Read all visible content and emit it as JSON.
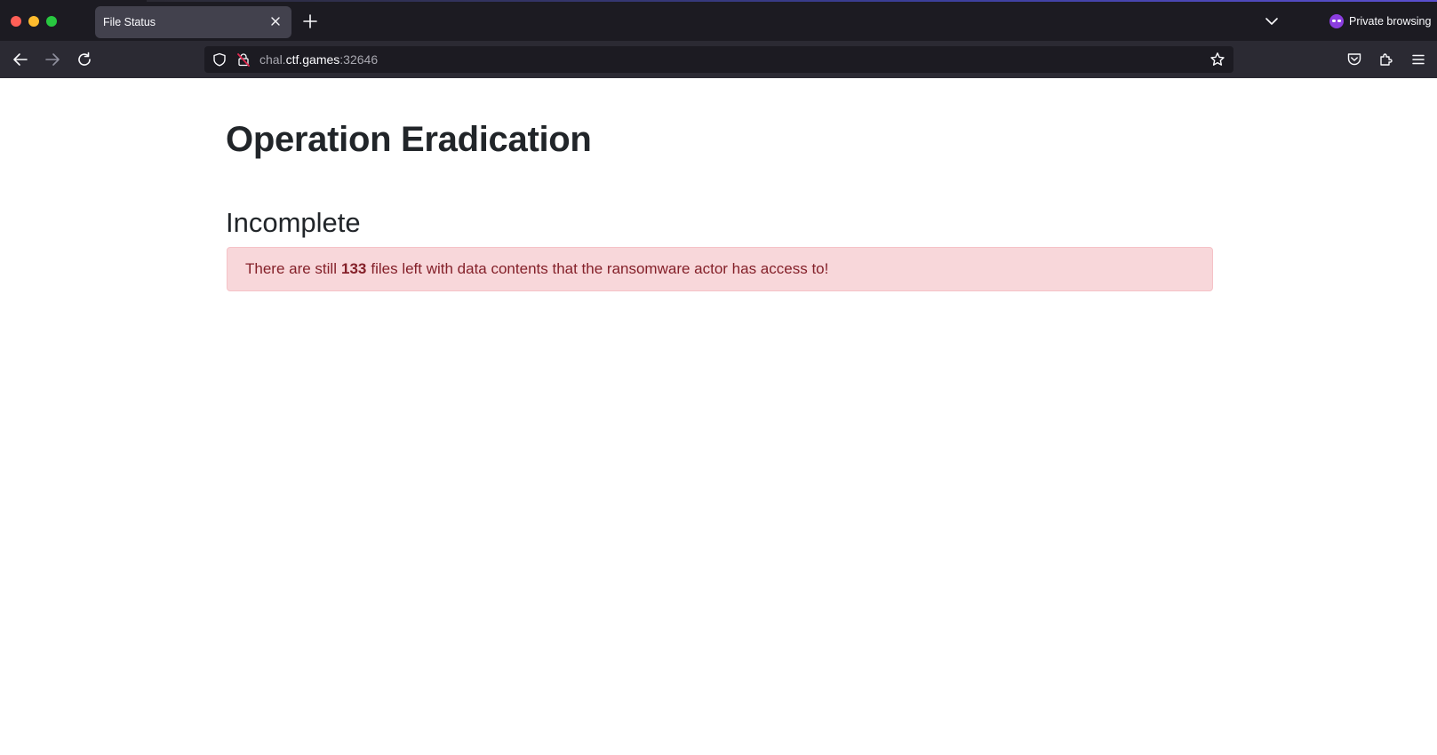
{
  "browser": {
    "tab": {
      "title": "File Status"
    },
    "private_label": "Private browsing",
    "url": {
      "prefix": "chal.",
      "domain": "ctf.games",
      "port": ":32646"
    },
    "colors": {
      "chrome_bg": "#1c1b22",
      "toolbar_bg": "#2b2a33",
      "tab_bg": "#42414d",
      "private_accent": "#8b3de0"
    }
  },
  "page": {
    "title": "Operation Eradication",
    "status_heading": "Incomplete",
    "alert": {
      "text_before": "There are still",
      "count": "133",
      "text_after": "files left with data contents that the ransomware actor has access to!",
      "colors": {
        "background": "#f8d7da",
        "border": "#f5c2c7",
        "text": "#842029"
      }
    }
  }
}
